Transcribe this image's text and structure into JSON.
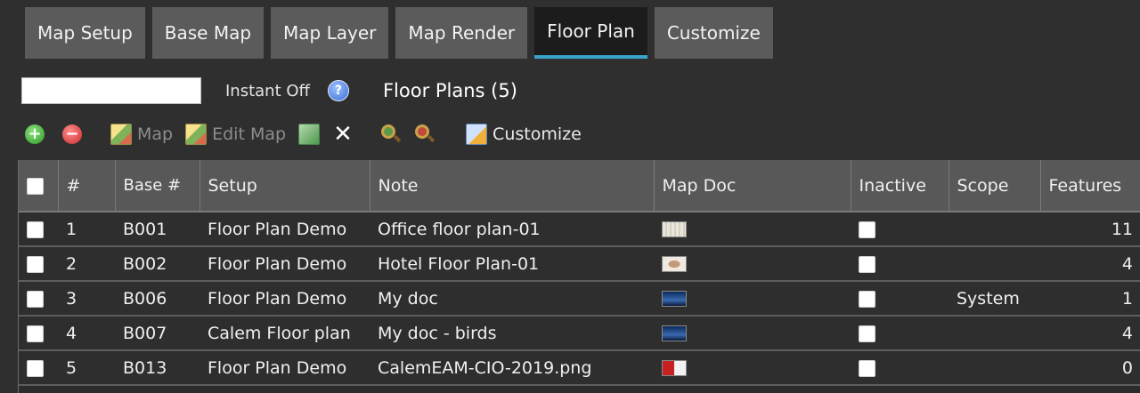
{
  "tabs": [
    {
      "label": "Map Setup",
      "active": false
    },
    {
      "label": "Base Map",
      "active": false
    },
    {
      "label": "Map Layer",
      "active": false
    },
    {
      "label": "Map Render",
      "active": false
    },
    {
      "label": "Floor Plan",
      "active": true
    },
    {
      "label": "Customize",
      "active": false
    }
  ],
  "search": {
    "value": "",
    "instant_label": "Instant Off",
    "help_icon": "help-icon"
  },
  "title": "Floor Plans (5)",
  "toolbar": {
    "add_icon": "plus-circle-icon",
    "remove_icon": "minus-circle-icon",
    "map_label": "Map",
    "edit_map_label": "Edit Map",
    "customize_label": "Customize"
  },
  "table": {
    "headers": {
      "num": "#",
      "base": "Base #",
      "setup": "Setup",
      "note": "Note",
      "map_doc": "Map Doc",
      "inactive": "Inactive",
      "scope": "Scope",
      "features": "Features"
    },
    "rows": [
      {
        "num": "1",
        "base": "B001",
        "setup": "Floor Plan Demo",
        "note": "Office floor plan-01",
        "map_doc": "floor-plan-thumbnail",
        "scope": "",
        "features": "11"
      },
      {
        "num": "2",
        "base": "B002",
        "setup": "Floor Plan Demo",
        "note": "Hotel Floor Plan-01",
        "map_doc": "hotel-plan-thumbnail",
        "scope": "",
        "features": "4"
      },
      {
        "num": "3",
        "base": "B006",
        "setup": "Floor Plan Demo",
        "note": "My doc",
        "map_doc": "doc-thumbnail",
        "scope": "System",
        "features": "1"
      },
      {
        "num": "4",
        "base": "B007",
        "setup": "Calem Floor plan",
        "note": "My doc - birds",
        "map_doc": "doc-thumbnail",
        "scope": "",
        "features": "4"
      },
      {
        "num": "5",
        "base": "B013",
        "setup": "Floor Plan Demo",
        "note": "CalemEAM-CIO-2019.png",
        "map_doc": "cio-thumbnail",
        "scope": "",
        "features": "0"
      }
    ]
  },
  "colors": {
    "tab_active_underline": "#3aa3c9",
    "header_bg": "#585858",
    "page_bg": "#2f2f2f"
  }
}
